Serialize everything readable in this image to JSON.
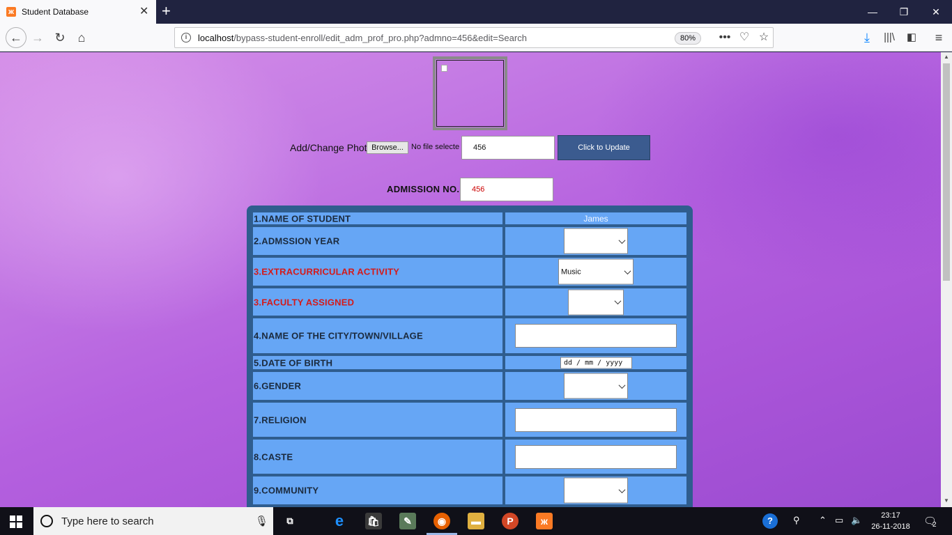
{
  "browser": {
    "tab_title": "Student Database",
    "tab_close": "✕",
    "new_tab": "+",
    "win_min": "—",
    "win_restore": "❐",
    "win_close": "✕",
    "url_host": "localhost",
    "url_path": "/bypass-student-enroll/edit_adm_prof_pro.php?admno=456&edit=Search",
    "zoom": "80%",
    "icons": [
      "back-icon",
      "forward-icon",
      "reload-icon",
      "home-icon",
      "info-icon",
      "more-icon",
      "pocket-icon",
      "star-icon",
      "download-icon",
      "library-icon",
      "sidebar-icon",
      "menu-icon"
    ]
  },
  "form": {
    "upload_label": "Add/Change Photo",
    "browse_label": "Browse...",
    "no_file_text": "No file selecte",
    "admno_input_value": "456",
    "update_button": "Click to Update",
    "admission_label": "ADMISSION NO.",
    "admission_value": "456",
    "rows": [
      {
        "label": "1.NAME OF STUDENT",
        "value": "James"
      },
      {
        "label": "2.ADMSSION YEAR",
        "value": ""
      },
      {
        "label": "3.EXTRACURRICULAR ACTIVITY",
        "value": "Music"
      },
      {
        "label": "3.FACULTY ASSIGNED",
        "value": ""
      },
      {
        "label": "4.NAME OF THE CITY/TOWN/VILLAGE",
        "value": ""
      },
      {
        "label": "5.DATE OF BIRTH",
        "value": "dd / mm / yyyy"
      },
      {
        "label": "6.GENDER",
        "value": ""
      },
      {
        "label": "7.RELIGION",
        "value": ""
      },
      {
        "label": "8.CASTE",
        "value": ""
      },
      {
        "label": "9.COMMUNITY",
        "value": ""
      }
    ],
    "colors": {
      "cell": "#66a6f5",
      "box": "#2f5d8e",
      "red_label": "#d41a1a",
      "button": "#3b5b8f"
    }
  },
  "taskbar": {
    "search_text": "Type here to search",
    "time": "23:17",
    "date": "26-11-2018",
    "notification_count": "2",
    "apps": [
      "task-view-icon",
      "edge-icon",
      "store-icon",
      "evernote-icon",
      "firefox-icon",
      "file-explorer-icon",
      "powerpoint-icon",
      "xampp-icon"
    ]
  }
}
